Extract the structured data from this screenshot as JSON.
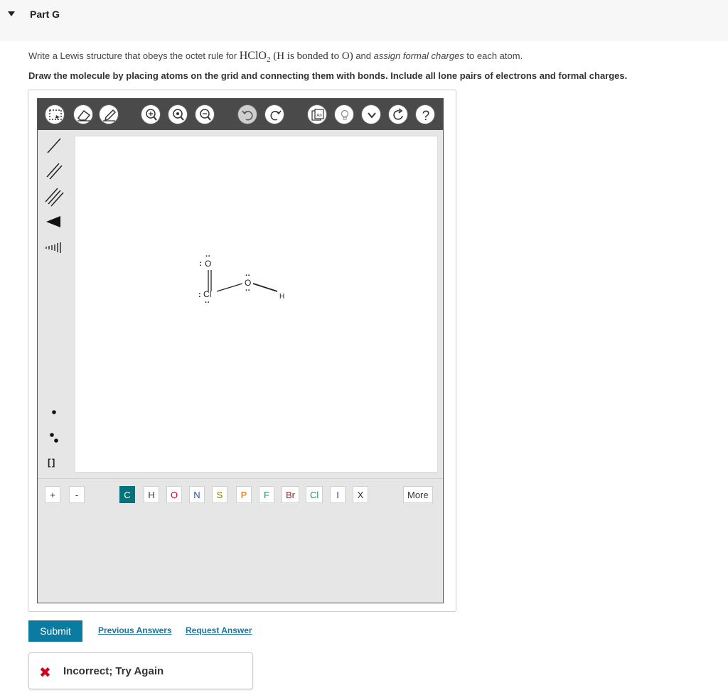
{
  "part": {
    "title": "Part G"
  },
  "question": {
    "prefix": "Write a Lewis structure that obeys the octet rule for ",
    "formula_main": "HClO",
    "formula_sub": "2",
    "paren": " (H is bonded to O)",
    "mid": " and ",
    "emphasis": "assign formal charges",
    "suffix": " to each atom."
  },
  "instruction": "Draw the molecule by placing atoms on the grid and connecting them with bonds. Include all lone pairs of electrons and formal charges.",
  "toolbar": {
    "icons": [
      "select-icon",
      "eraser-icon",
      "pencil-icon",
      "zoom-in-icon",
      "zoom-reset-icon",
      "zoom-out-icon",
      "undo-icon",
      "redo-icon",
      "template-icon",
      "hint-icon",
      "chevron-down-icon",
      "refresh-icon",
      "help-icon"
    ],
    "template_label": "An",
    "help_label": "?"
  },
  "left_tools": [
    "single-bond-icon",
    "double-bond-icon",
    "triple-bond-icon",
    "wedge-bond-icon",
    "hash-bond-icon",
    "radical-icon",
    "lone-pair-icon",
    "bracket-icon"
  ],
  "bracket_label": "[ ]",
  "molecule": {
    "atoms": [
      {
        "symbol": "O",
        "lone": ":"
      },
      {
        "symbol": "Cl",
        "lone": ":"
      },
      {
        "symbol": "O",
        "lone": ""
      },
      {
        "symbol": "H",
        "lone": ""
      }
    ],
    "o1_dots": "··",
    "cl_dots": "··",
    "o2_top": "··",
    "o2_bottom": "··"
  },
  "charges": {
    "plus": "+",
    "minus": "-"
  },
  "atom_buttons": [
    {
      "label": "C",
      "color": "#ffffff"
    },
    {
      "label": "H",
      "color": "#333333"
    },
    {
      "label": "O",
      "color": "#d0021b"
    },
    {
      "label": "N",
      "color": "#1f4fb5"
    },
    {
      "label": "S",
      "color": "#8a7a00"
    },
    {
      "label": "P",
      "color": "#d46a00"
    },
    {
      "label": "F",
      "color": "#2e8b57"
    },
    {
      "label": "Br",
      "color": "#8b2a2a"
    },
    {
      "label": "Cl",
      "color": "#2e8b57"
    },
    {
      "label": "I",
      "color": "#6a2a9a"
    },
    {
      "label": "X",
      "color": "#333333"
    }
  ],
  "more_label": "More",
  "actions": {
    "submit": "Submit",
    "previous_answers": "Previous Answers",
    "request_answer": "Request Answer"
  },
  "feedback": {
    "icon": "✖",
    "text": "Incorrect; Try Again",
    "color": "#d0021b"
  }
}
